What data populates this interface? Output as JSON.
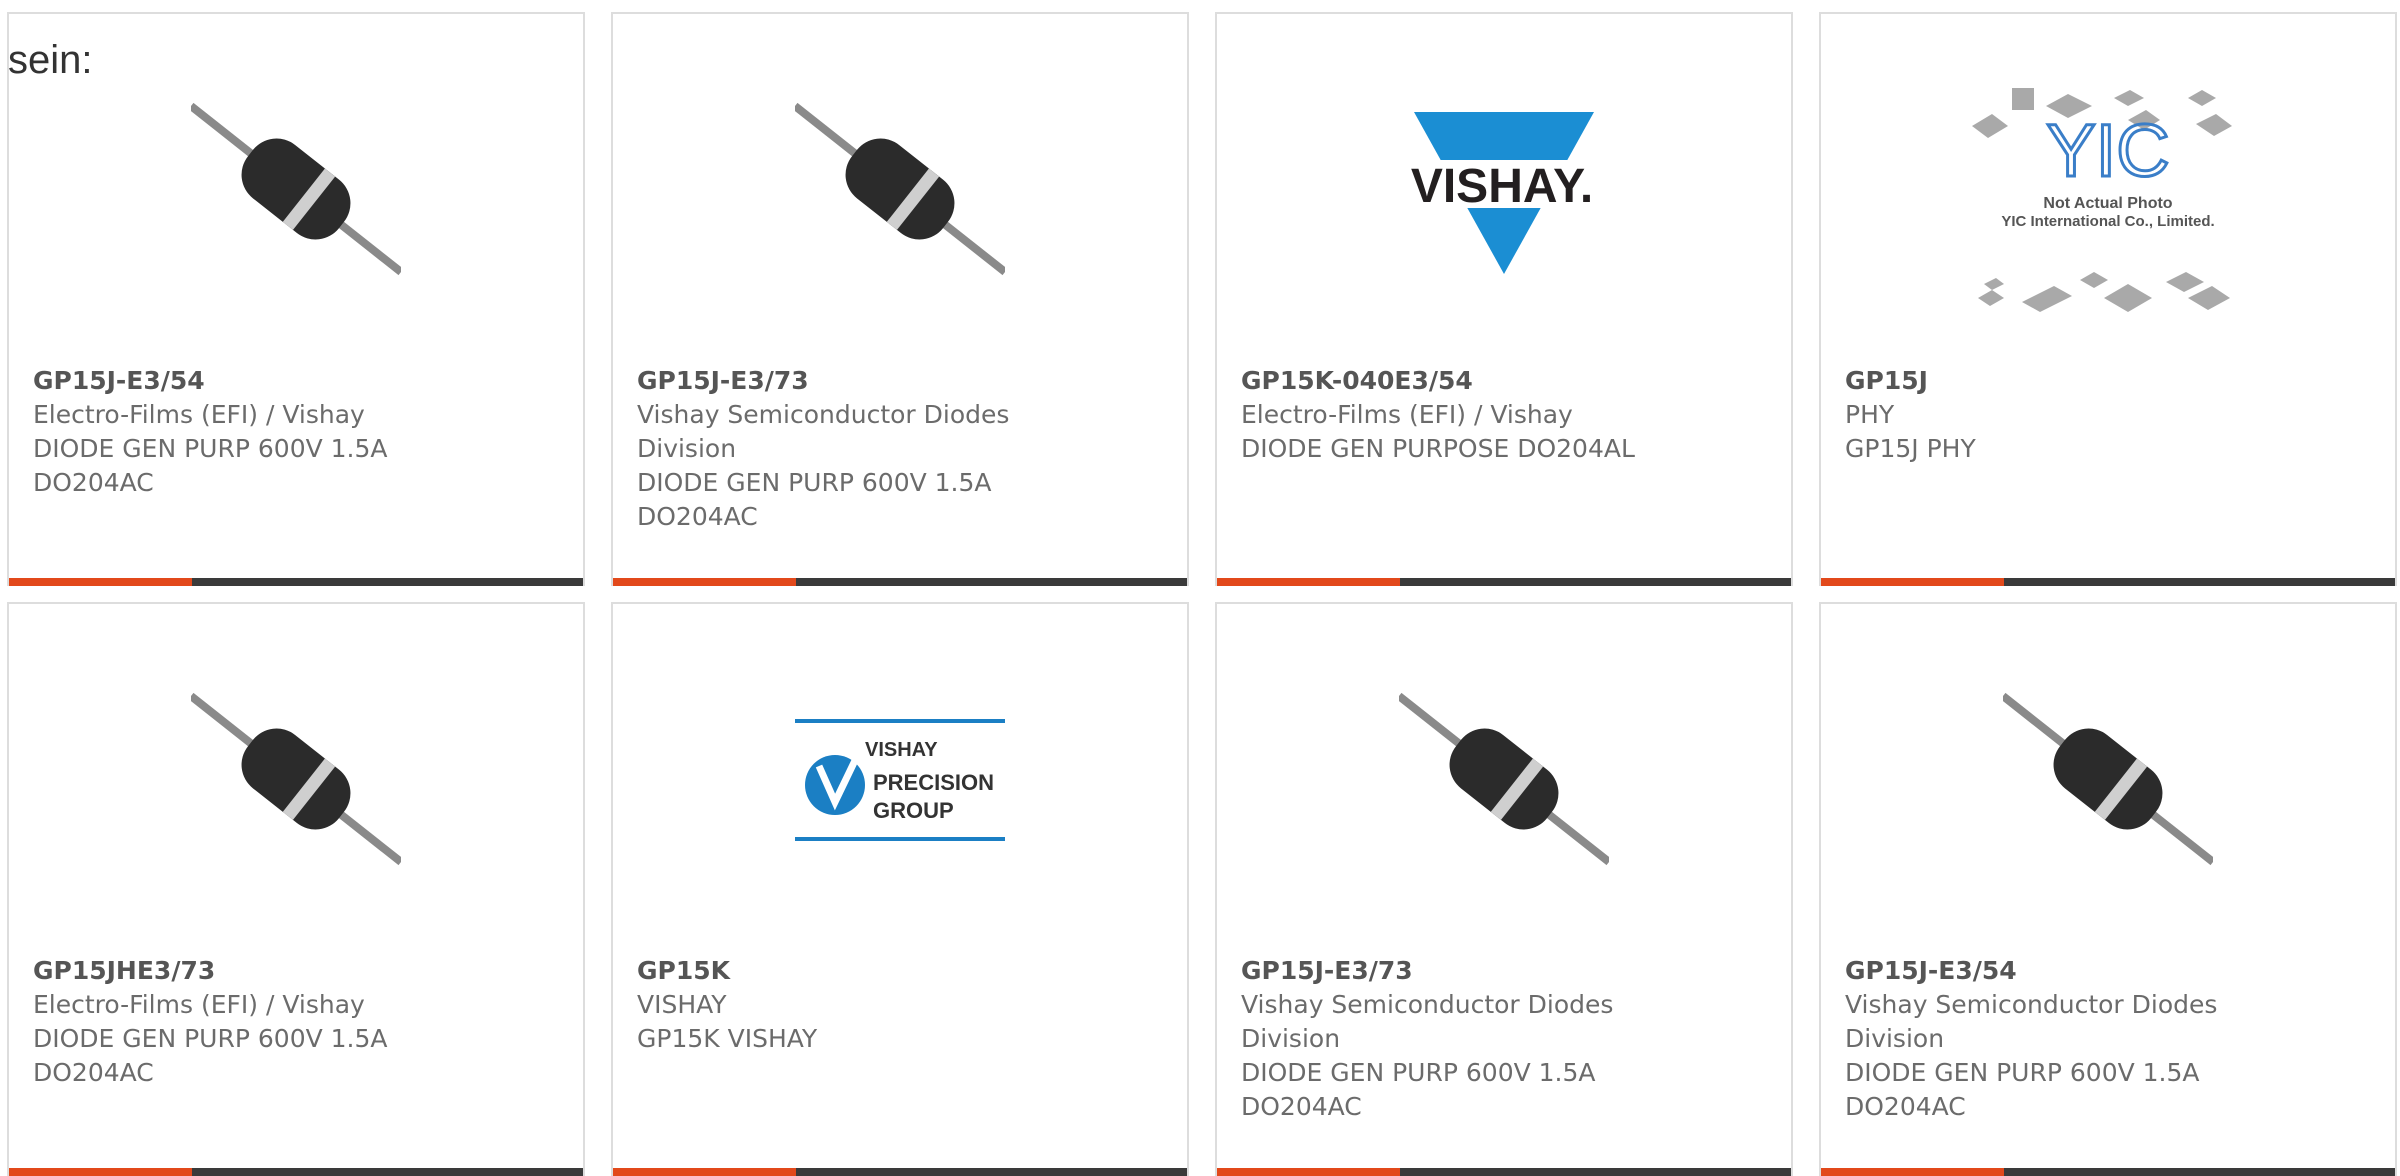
{
  "intro_text": "sein:",
  "colors": {
    "accent": "#e2491b",
    "bar": "#3a3a3a",
    "text": "#6b6b6b",
    "border": "#dddddd"
  },
  "cards": [
    {
      "part_number": "GP15J-E3/54",
      "manufacturer": "Electro-Films (EFI) / Vishay",
      "description": "DIODE GEN PURP 600V 1.5A DO204AC",
      "image": "diode-photo"
    },
    {
      "part_number": "GP15J-E3/73",
      "manufacturer": "Vishay Semiconductor Diodes Division",
      "description": "DIODE GEN PURP 600V 1.5A DO204AC",
      "image": "diode-photo"
    },
    {
      "part_number": "GP15K-040E3/54",
      "manufacturer": "Electro-Films (EFI) / Vishay",
      "description": "DIODE GEN PURPOSE DO204AL",
      "image": "vishay-logo",
      "logo_text": "VISHAY."
    },
    {
      "part_number": "GP15J",
      "manufacturer": "PHY",
      "description": "GP15J PHY",
      "image": "not-actual-photo",
      "logo_text": "YIC",
      "caption_line1": "Not Actual Photo",
      "caption_line2": "YIC International Co., Limited."
    },
    {
      "part_number": "GP15JHE3/73",
      "manufacturer": "Electro-Films (EFI) / Vishay",
      "description": "DIODE GEN PURP 600V 1.5A DO204AC",
      "image": "diode-photo"
    },
    {
      "part_number": "GP15K",
      "manufacturer": "VISHAY",
      "description": "GP15K VISHAY",
      "image": "vishay-precision-logo",
      "logo_line1": "VISHAY",
      "logo_line2": "PRECISION",
      "logo_line3": "GROUP"
    },
    {
      "part_number": "GP15J-E3/73",
      "manufacturer": "Vishay Semiconductor Diodes Division",
      "description": "DIODE GEN PURP 600V 1.5A DO204AC",
      "image": "diode-photo"
    },
    {
      "part_number": "GP15J-E3/54",
      "manufacturer": "Vishay Semiconductor Diodes Division",
      "description": "DIODE GEN PURP 600V 1.5A DO204AC",
      "image": "diode-photo"
    }
  ]
}
